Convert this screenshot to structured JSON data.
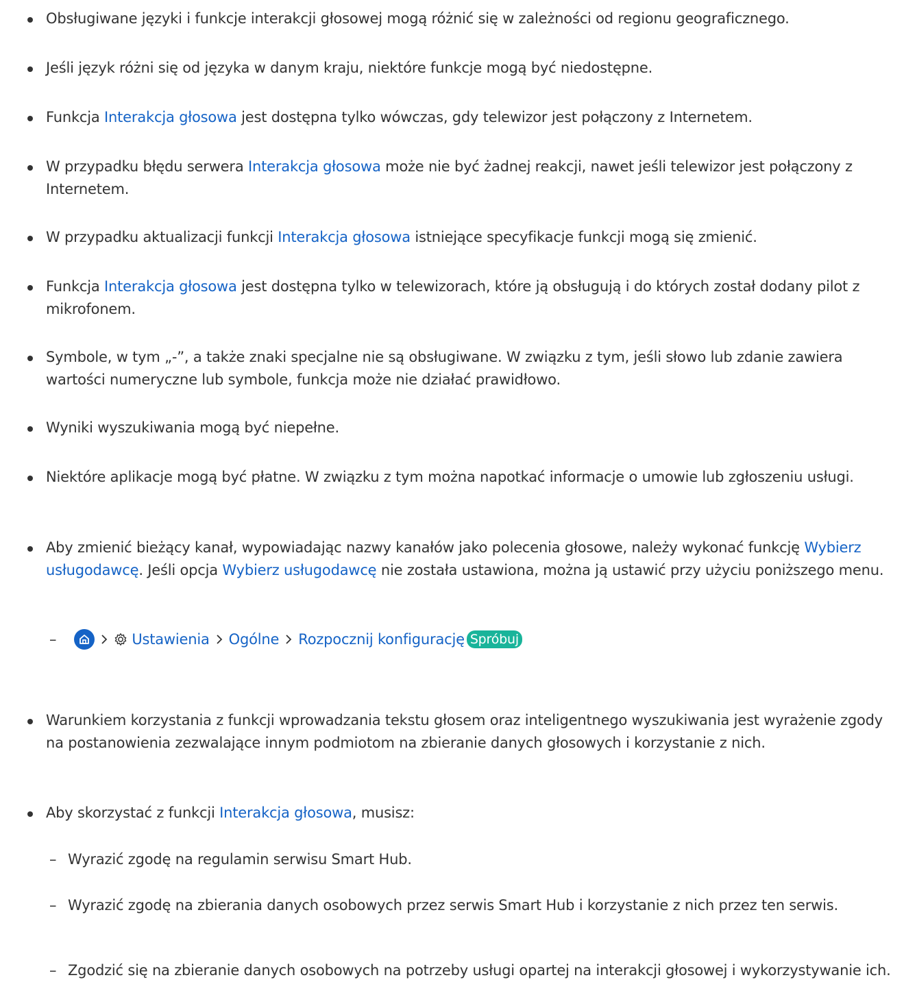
{
  "items": [
    {
      "parts": [
        {
          "t": "Obsługiwane języki i funkcje interakcji głosowej mogą różnić się w zależności od regionu geograficznego."
        }
      ]
    },
    {
      "parts": [
        {
          "t": "Jeśli język różni się od języka w danym kraju, niektóre funkcje mogą być niedostępne."
        }
      ]
    },
    {
      "parts": [
        {
          "t": "Funkcja "
        },
        {
          "t": "Interakcja głosowa",
          "link": true
        },
        {
          "t": " jest dostępna tylko wówczas, gdy telewizor jest połączony z Internetem."
        }
      ]
    },
    {
      "parts": [
        {
          "t": "W przypadku błędu serwera "
        },
        {
          "t": "Interakcja głosowa",
          "link": true
        },
        {
          "t": " może nie być żadnej reakcji, nawet jeśli telewizor jest połączony z Internetem."
        }
      ]
    },
    {
      "parts": [
        {
          "t": "W przypadku aktualizacji funkcji "
        },
        {
          "t": "Interakcja głosowa",
          "link": true
        },
        {
          "t": " istniejące specyfikacje funkcji mogą się zmienić."
        }
      ]
    },
    {
      "parts": [
        {
          "t": "Funkcja "
        },
        {
          "t": "Interakcja głosowa",
          "link": true
        },
        {
          "t": " jest dostępna tylko w telewizorach, które ją obsługują i do których został dodany pilot z mikrofonem."
        }
      ]
    },
    {
      "parts": [
        {
          "t": "Symbole, w tym „-”, a także znaki specjalne nie są obsługiwane. W związku z tym, jeśli słowo lub zdanie zawiera wartości numeryczne lub symbole, funkcja może nie działać prawidłowo."
        }
      ]
    },
    {
      "parts": [
        {
          "t": "Wyniki wyszukiwania mogą być niepełne."
        }
      ]
    },
    {
      "parts": [
        {
          "t": "Niektóre aplikacje mogą być płatne. W związku z tym można napotkać informacje o umowie lub zgłoszeniu usługi."
        }
      ]
    },
    {
      "parts": [
        {
          "t": "Aby zmienić bieżący kanał, wypowiadając nazwy kanałów jako polecenia głosowe, należy wykonać funkcję "
        },
        {
          "t": "Wybierz usługodawcę",
          "link": true
        },
        {
          "t": ". Jeśli opcja "
        },
        {
          "t": "Wybierz usługodawcę",
          "link": true
        },
        {
          "t": " nie została ustawiona, można ją ustawić przy użyciu poniższego menu."
        }
      ]
    },
    {
      "parts": [
        {
          "t": "Warunkiem korzystania z funkcji wprowadzania tekstu głosem oraz inteligentnego wyszukiwania jest wyrażenie zgody na postanowienia zezwalające innym podmiotom na zbieranie danych głosowych i korzystanie z nich."
        }
      ]
    },
    {
      "parts": [
        {
          "t": "Aby skorzystać z funkcji "
        },
        {
          "t": "Interakcja głosowa",
          "link": true
        },
        {
          "t": ", musisz:"
        }
      ]
    }
  ],
  "menu_path": {
    "dash": "–",
    "icons": [
      "home-icon",
      "chevron-right-icon",
      "gear-icon"
    ],
    "settings": "Ustawienia",
    "general": "Ogólne",
    "start_setup": "Rozpocznij konfigurację",
    "try_badge": "Spróbuj"
  },
  "sub_items": [
    {
      "dash": "–",
      "text": "Wyrazić zgodę na regulamin serwisu Smart Hub."
    },
    {
      "dash": "–",
      "text": "Wyrazić zgodę na zbierania danych osobowych przez serwis Smart Hub i korzystanie z nich przez ten serwis."
    },
    {
      "dash": "–",
      "text": "Zgodzić się na zbieranie danych osobowych na potrzeby usługi opartej na interakcji głosowej i wykorzystywanie ich."
    }
  ],
  "colors": {
    "text": "#333333",
    "link": "#1563c6",
    "badge": "#19b49a"
  }
}
